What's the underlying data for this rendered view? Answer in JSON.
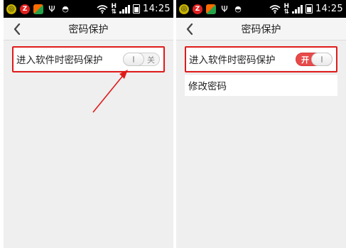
{
  "status_bar": {
    "time": "14:25",
    "network": "H",
    "icons": [
      "sync-circle-icon",
      "z-app-icon",
      "colorful-app-icon",
      "usb-icon",
      "android-icon",
      "wifi-icon",
      "h-network-icon",
      "signal-icon",
      "battery-icon"
    ]
  },
  "screens": [
    {
      "title": "密码保护",
      "protection_row": {
        "label": "进入软件时密码保护",
        "toggle_text": "关",
        "enabled": false
      },
      "annotation": {
        "highlight_color": "#e01a1a",
        "arrow": true
      }
    },
    {
      "title": "密码保护",
      "protection_row": {
        "label": "进入软件时密码保护",
        "toggle_text": "开",
        "enabled": true
      },
      "change_password_label": "修改密码",
      "annotation": {
        "highlight_color": "#e01a1a"
      }
    }
  ],
  "colors": {
    "toggle_on": "#e84a4a",
    "annotation": "#e01a1a"
  }
}
